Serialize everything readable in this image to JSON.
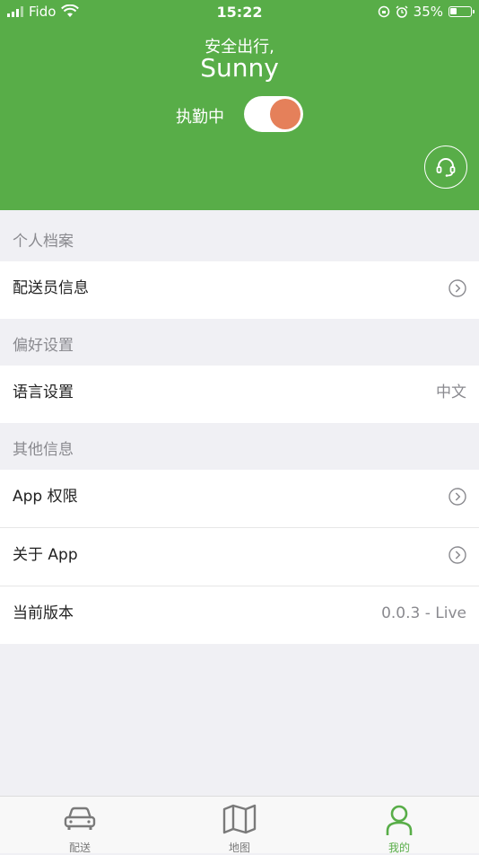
{
  "status_bar": {
    "carrier": "Fido",
    "time": "15:22",
    "battery_percent": "35%",
    "battery_level": 0.35
  },
  "header": {
    "greeting": "安全出行,",
    "username": "Sunny",
    "duty_label": "执勤中",
    "duty_on": true
  },
  "sections": [
    {
      "title": "个人档案",
      "rows": [
        {
          "label": "配送员信息"
        }
      ]
    },
    {
      "title": "偏好设置",
      "rows": [
        {
          "label": "语言设置",
          "value": "中文"
        }
      ]
    },
    {
      "title": "其他信息",
      "rows": [
        {
          "label": "App 权限"
        },
        {
          "label": "关于 App"
        },
        {
          "label": "当前版本",
          "value": "0.0.3 - Live"
        }
      ]
    }
  ],
  "tabbar": {
    "tabs": [
      {
        "label": "配送"
      },
      {
        "label": "地图"
      },
      {
        "label": "我的"
      }
    ],
    "active_index": 2
  },
  "colors": {
    "brand_green": "#58ad48",
    "toggle_knob": "#e5805a",
    "background": "#f0f0f4"
  }
}
